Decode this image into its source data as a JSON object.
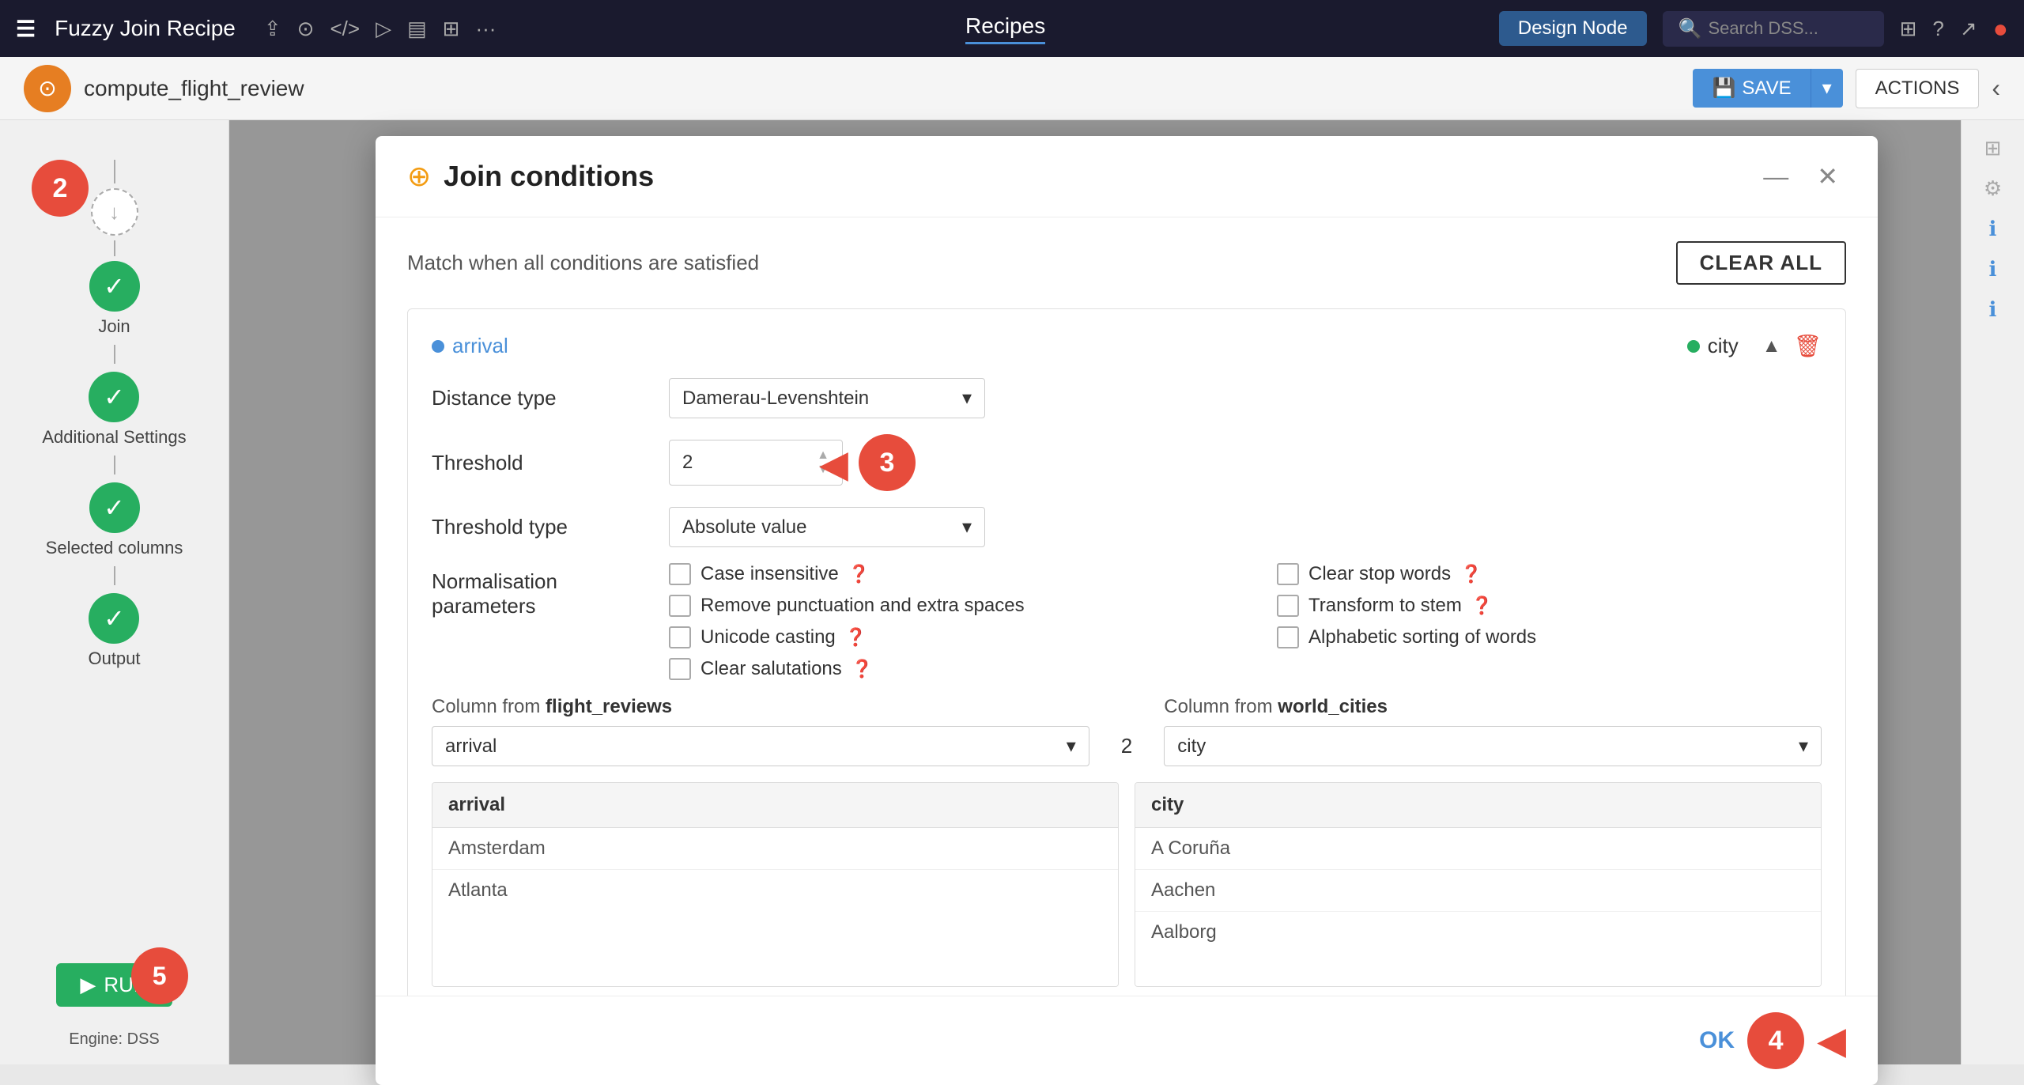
{
  "topbar": {
    "app_name": "Fuzzy Join Recipe",
    "nav_items": [
      "share-icon",
      "refresh-icon",
      "code-icon",
      "play-icon",
      "data-icon",
      "grid-icon",
      "more-icon"
    ],
    "center_tab": "Recipes",
    "design_node_label": "Design Node",
    "search_placeholder": "Search DSS...",
    "apps_icon": "apps-icon",
    "help_icon": "help-icon",
    "stats_icon": "stats-icon",
    "user_icon": "user-icon"
  },
  "secondbar": {
    "title": "compute_flight_review",
    "save_label": "SAVE",
    "actions_label": "ACTIONS"
  },
  "sidebar": {
    "nodes": [
      {
        "label": "Join",
        "type": "green",
        "step": "2"
      },
      {
        "label": "Additional Settings",
        "type": "green"
      },
      {
        "label": "Selected columns",
        "type": "green"
      },
      {
        "label": "Output",
        "type": "green"
      }
    ],
    "run_label": "RUN",
    "engine_label": "Engine: DSS",
    "step5_label": "5"
  },
  "modal": {
    "title": "Join conditions",
    "subtitle": "Match when all conditions are satisfied",
    "clear_all_label": "CLEAR ALL",
    "condition": {
      "left_col": "arrival",
      "right_col": "city",
      "distance_type_label": "Distance type",
      "distance_type_value": "Damerau-Levenshtein",
      "threshold_label": "Threshold",
      "threshold_value": "2",
      "threshold_type_label": "Threshold type",
      "threshold_type_value": "Absolute value",
      "norm_params_label": "Normalisation parameters",
      "checkboxes": [
        {
          "id": "case_insensitive",
          "label": "Case insensitive",
          "help": true,
          "checked": false
        },
        {
          "id": "clear_stop_words",
          "label": "Clear stop words",
          "help": true,
          "checked": false
        },
        {
          "id": "remove_punctuation",
          "label": "Remove punctuation and extra spaces",
          "help": false,
          "checked": false
        },
        {
          "id": "transform_to_stem",
          "label": "Transform to stem",
          "help": true,
          "checked": false
        },
        {
          "id": "unicode_casting",
          "label": "Unicode casting",
          "help": true,
          "checked": false
        },
        {
          "id": "alphabetic_sorting",
          "label": "Alphabetic sorting of words",
          "help": false,
          "checked": false
        },
        {
          "id": "clear_salutations",
          "label": "Clear salutations",
          "help": true,
          "checked": false
        }
      ],
      "col_from_label": "Column from",
      "left_dataset": "flight_reviews",
      "right_dataset": "world_cities",
      "left_col_select": "arrival",
      "right_col_select": "city",
      "threshold_display": "2",
      "left_preview_header": "arrival",
      "left_preview_rows": [
        "Amsterdam",
        "Atlanta"
      ],
      "right_preview_header": "city",
      "right_preview_rows": [
        "A Coruña",
        "Aachen",
        "Aalborg"
      ]
    },
    "ok_label": "OK"
  },
  "annotations": {
    "step2": "2",
    "step3": "3",
    "step4": "4",
    "step5": "5"
  }
}
